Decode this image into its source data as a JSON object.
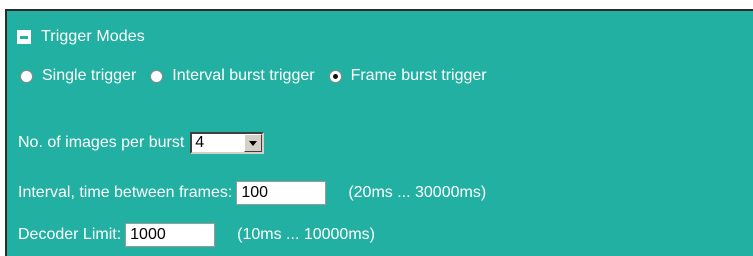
{
  "trigger_modes": {
    "title": "Trigger Modes",
    "options": [
      {
        "label": "Single trigger",
        "checked": false
      },
      {
        "label": "Interval burst trigger",
        "checked": false
      },
      {
        "label": "Frame burst trigger",
        "checked": true
      }
    ]
  },
  "images_per_burst": {
    "label": "No. of images per burst",
    "value": "4"
  },
  "interval": {
    "label": "Interval, time between frames:",
    "value": "100",
    "hint": "(20ms ... 30000ms)"
  },
  "decoder_limit": {
    "label": "Decoder Limit:",
    "value": "1000",
    "hint": "(10ms ... 10000ms)"
  },
  "colors": {
    "panel_background": "#21b0a2",
    "text": "#ffffff"
  }
}
